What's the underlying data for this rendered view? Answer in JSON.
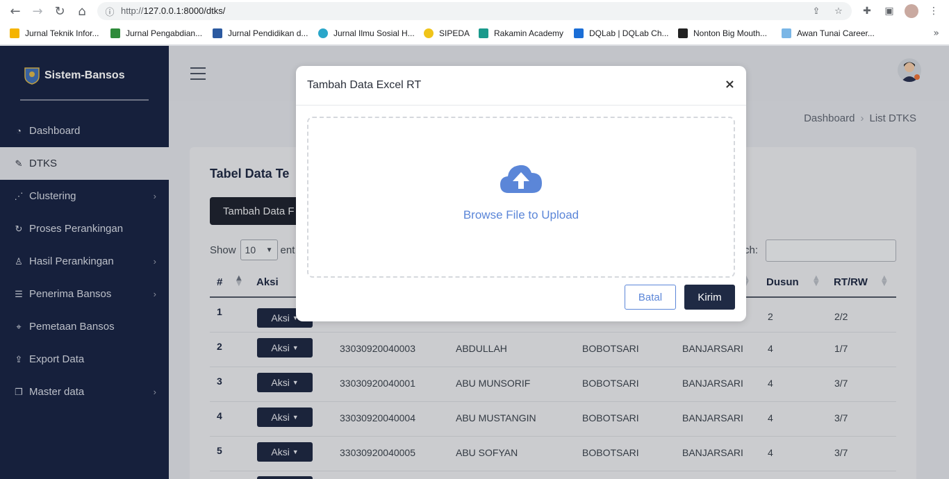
{
  "browser": {
    "url_prefix": "http://",
    "url_main": "127.0.0.1:8000/dtks/",
    "bookmarks": [
      {
        "label": "Jurnal Teknik Infor...",
        "color": "#f5b400"
      },
      {
        "label": "Jurnal Pengabdian...",
        "color": "#2e8b3a"
      },
      {
        "label": "Jurnal Pendidikan d...",
        "color": "#2c5aa0"
      },
      {
        "label": "Jurnal Ilmu Sosial H...",
        "color": "#2aa6c9"
      },
      {
        "label": "SIPEDA",
        "color": "#f0c419"
      },
      {
        "label": "Rakamin Academy",
        "color": "#1a9a8c"
      },
      {
        "label": "DQLab | DQLab Ch...",
        "color": "#1b6ed6"
      },
      {
        "label": "Nonton Big Mouth...",
        "color": "#222222"
      },
      {
        "label": "Awan Tunai Career...",
        "color": "#7ab6e6"
      }
    ]
  },
  "sidebar": {
    "brand": "Sistem-Bansos",
    "items": [
      {
        "label": "Dashboard",
        "icon": "gauge-icon",
        "glyph": "◔",
        "chevron": false
      },
      {
        "label": "DTKS",
        "icon": "edit-icon",
        "glyph": "✎",
        "chevron": false,
        "active": true
      },
      {
        "label": "Clustering",
        "icon": "cluster-icon",
        "glyph": "⋰",
        "chevron": true
      },
      {
        "label": "Proses Perankingan",
        "icon": "refresh-icon",
        "glyph": "↻",
        "chevron": false
      },
      {
        "label": "Hasil Perankingan",
        "icon": "award-icon",
        "glyph": "♙",
        "chevron": true
      },
      {
        "label": "Penerima Bansos",
        "icon": "list-icon",
        "glyph": "☰",
        "chevron": true
      },
      {
        "label": "Pemetaan Bansos",
        "icon": "map-pin-icon",
        "glyph": "⌖",
        "chevron": false
      },
      {
        "label": "Export Data",
        "icon": "upload-icon",
        "glyph": "⇪",
        "chevron": false
      },
      {
        "label": "Master data",
        "icon": "copy-icon",
        "glyph": "❐",
        "chevron": true
      }
    ]
  },
  "breadcrumb": {
    "home": "Dashboard",
    "separator": "›",
    "current": "List DTKS"
  },
  "card": {
    "title": "Tabel Data Te",
    "add_button": "Tambah Data F",
    "show_label": "Show",
    "entries_value": "10",
    "entries_suffix": "ent",
    "search_label": "rch:"
  },
  "table": {
    "headers": {
      "num": "#",
      "aksi": "Aksi",
      "dusun": "Dusun",
      "rtrw": "RT/RW"
    },
    "rows": [
      {
        "num": "1",
        "aksi": "Aksi",
        "nik": "",
        "nama": "",
        "desa": "",
        "kec": "",
        "dusun": "2",
        "rtrw": "2/2"
      },
      {
        "num": "2",
        "aksi": "Aksi",
        "nik": "33030920040003",
        "nama": "ABDULLAH",
        "desa": "BOBOTSARI",
        "kec": "BANJARSARI",
        "dusun": "4",
        "rtrw": "1/7"
      },
      {
        "num": "3",
        "aksi": "Aksi",
        "nik": "33030920040001",
        "nama": "ABU MUNSORIF",
        "desa": "BOBOTSARI",
        "kec": "BANJARSARI",
        "dusun": "4",
        "rtrw": "3/7"
      },
      {
        "num": "4",
        "aksi": "Aksi",
        "nik": "33030920040004",
        "nama": "ABU MUSTANGIN",
        "desa": "BOBOTSARI",
        "kec": "BANJARSARI",
        "dusun": "4",
        "rtrw": "3/7"
      },
      {
        "num": "5",
        "aksi": "Aksi",
        "nik": "33030920040005",
        "nama": "ABU SOFYAN",
        "desa": "BOBOTSARI",
        "kec": "BANJARSARI",
        "dusun": "4",
        "rtrw": "3/7"
      }
    ]
  },
  "modal": {
    "title": "Tambah Data Excel RT",
    "close": "×",
    "browse_text": "Browse File to Upload",
    "cancel_label": "Batal",
    "submit_label": "Kirim"
  },
  "colors": {
    "sidebar_bg": "#1a2545",
    "accent": "#5b86d8",
    "primary_dark": "#1f2a44"
  }
}
